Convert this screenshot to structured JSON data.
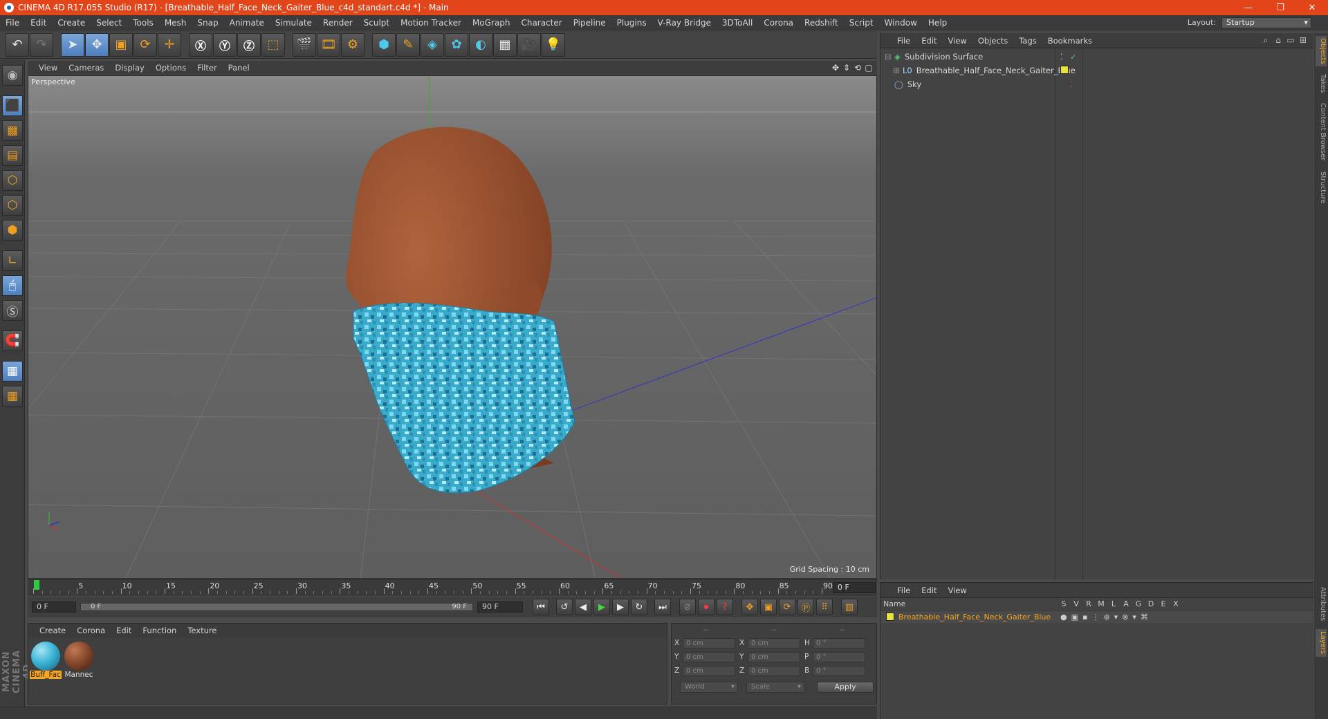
{
  "title": "CINEMA 4D R17.055 Studio (R17) - [Breathable_Half_Face_Neck_Gaiter_Blue_c4d_standart.c4d *] - Main",
  "window_controls": [
    "—",
    "❐",
    "✕"
  ],
  "menu": [
    "File",
    "Edit",
    "Create",
    "Select",
    "Tools",
    "Mesh",
    "Snap",
    "Animate",
    "Simulate",
    "Render",
    "Sculpt",
    "Motion Tracker",
    "MoGraph",
    "Character",
    "Pipeline",
    "Plugins",
    "V-Ray Bridge",
    "3DToAll",
    "Corona",
    "Redshift",
    "Script",
    "Window",
    "Help"
  ],
  "layout": {
    "label": "Layout:",
    "value": "Startup"
  },
  "viewport": {
    "menu": [
      "View",
      "Cameras",
      "Display",
      "Options",
      "Filter",
      "Panel"
    ],
    "label": "Perspective",
    "grid_spacing": "Grid Spacing : 10 cm"
  },
  "timeline": {
    "ticks": [
      "0",
      "5",
      "10",
      "15",
      "20",
      "25",
      "30",
      "35",
      "40",
      "45",
      "50",
      "55",
      "60",
      "65",
      "70",
      "75",
      "80",
      "85",
      "90"
    ],
    "current_frame": "0 F"
  },
  "transport": {
    "start": "0 F",
    "range_start": "0 F",
    "range_end": "90 F",
    "end": "90 F"
  },
  "materials": {
    "menu": [
      "Create",
      "Corona",
      "Edit",
      "Function",
      "Texture"
    ],
    "items": [
      {
        "name": "Buff_Fac",
        "color": "#3bb6d6"
      },
      {
        "name": "Mannec",
        "color": "#8a4a2e"
      }
    ]
  },
  "coordinates": {
    "headers": [
      "--",
      "--",
      "--"
    ],
    "rows": [
      {
        "a": "X",
        "av": "0 cm",
        "b": "X",
        "bv": "0 cm",
        "c": "H",
        "cv": "0 °"
      },
      {
        "a": "Y",
        "av": "0 cm",
        "b": "Y",
        "bv": "0 cm",
        "c": "P",
        "cv": "0 °"
      },
      {
        "a": "Z",
        "av": "0 cm",
        "b": "Z",
        "bv": "0 cm",
        "c": "B",
        "cv": "0 °"
      }
    ],
    "mode": "World",
    "scale": "Scale",
    "apply": "Apply"
  },
  "objects": {
    "menu": [
      "File",
      "Edit",
      "View",
      "Objects",
      "Tags",
      "Bookmarks"
    ],
    "items": [
      {
        "name": "Subdivision Surface"
      },
      {
        "name": "Breathable_Half_Face_Neck_Gaiter_Blue"
      },
      {
        "name": "Sky"
      }
    ]
  },
  "side_tabs": [
    "Objects",
    "Takes",
    "Content Browser",
    "Structure"
  ],
  "side_tabs_lower": [
    "Attributes",
    "Layers"
  ],
  "layers": {
    "menu": [
      "File",
      "Edit",
      "View"
    ],
    "columns": [
      "Name",
      "S",
      "V",
      "R",
      "M",
      "L",
      "A",
      "G",
      "D",
      "E",
      "X"
    ],
    "rows": [
      {
        "name": "Breathable_Half_Face_Neck_Gaiter_Blue"
      }
    ]
  },
  "colors": {
    "accent": "#e2451a",
    "selected": "#f5a623",
    "gaiter": "#3bb6d6",
    "skin": "#a0532f"
  },
  "branding": "MAXON CINEMA 4D"
}
